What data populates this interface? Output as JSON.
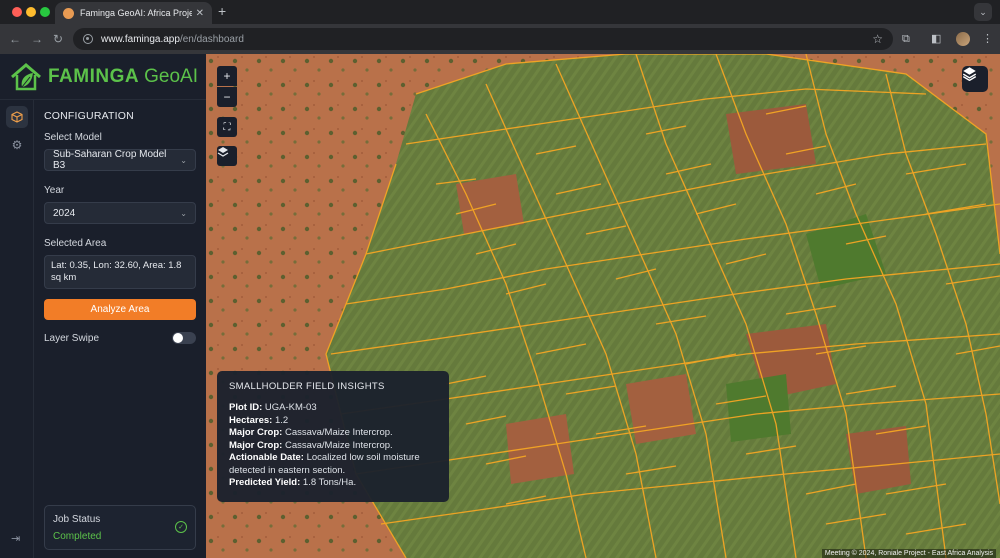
{
  "browser": {
    "tab_title": "Faminga GeoAI: Africa Project",
    "url_host": "www.famínga.app",
    "url_host_plain": "www.faminga.app",
    "url_path": "/en/dashboard"
  },
  "brand": {
    "name": "FAMINGA",
    "suffix": "GeoAI"
  },
  "config": {
    "title": "CONFIGURATION",
    "model_label": "Select Model",
    "model_value": "Sub-Saharan Crop Model B3",
    "year_label": "Year",
    "year_value": "2024",
    "area_label": "Selected Area",
    "area_value": "Lat: 0.35, Lon: 32.60, Area: 1.8 sq km",
    "analyze_label": "Analyze Area",
    "swipe_label": "Layer Swipe",
    "swipe_on": false
  },
  "job": {
    "title": "Job Status",
    "status": "Completed"
  },
  "map_controls": {
    "zoom_in": "+",
    "zoom_out": "−"
  },
  "insights": {
    "title": "SMALLHOLDER FIELD INSIGHTS",
    "rows": [
      {
        "label": "Plot ID:",
        "value": "UGA-KM-03"
      },
      {
        "label": "Hectares:",
        "value": "1.2"
      },
      {
        "label": "Major Crop:",
        "value": "Cassava/Maize Intercrop."
      },
      {
        "label": "Major Crop:",
        "value": "Cassava/Maize Intercrop."
      },
      {
        "label": "Actionable Date:",
        "value": "Localized low soil moisture detected in eastern section."
      },
      {
        "label": "Predicted Yield:",
        "value": "1.8 Tons/Ha."
      }
    ]
  },
  "attribution": "Meeting © 2024, Roniale Project - East Africa Analysis",
  "colors": {
    "accent": "#f27d27",
    "brand_green": "#5cc24a",
    "field_outline": "#f5a623",
    "panel": "#1a1f2b"
  }
}
